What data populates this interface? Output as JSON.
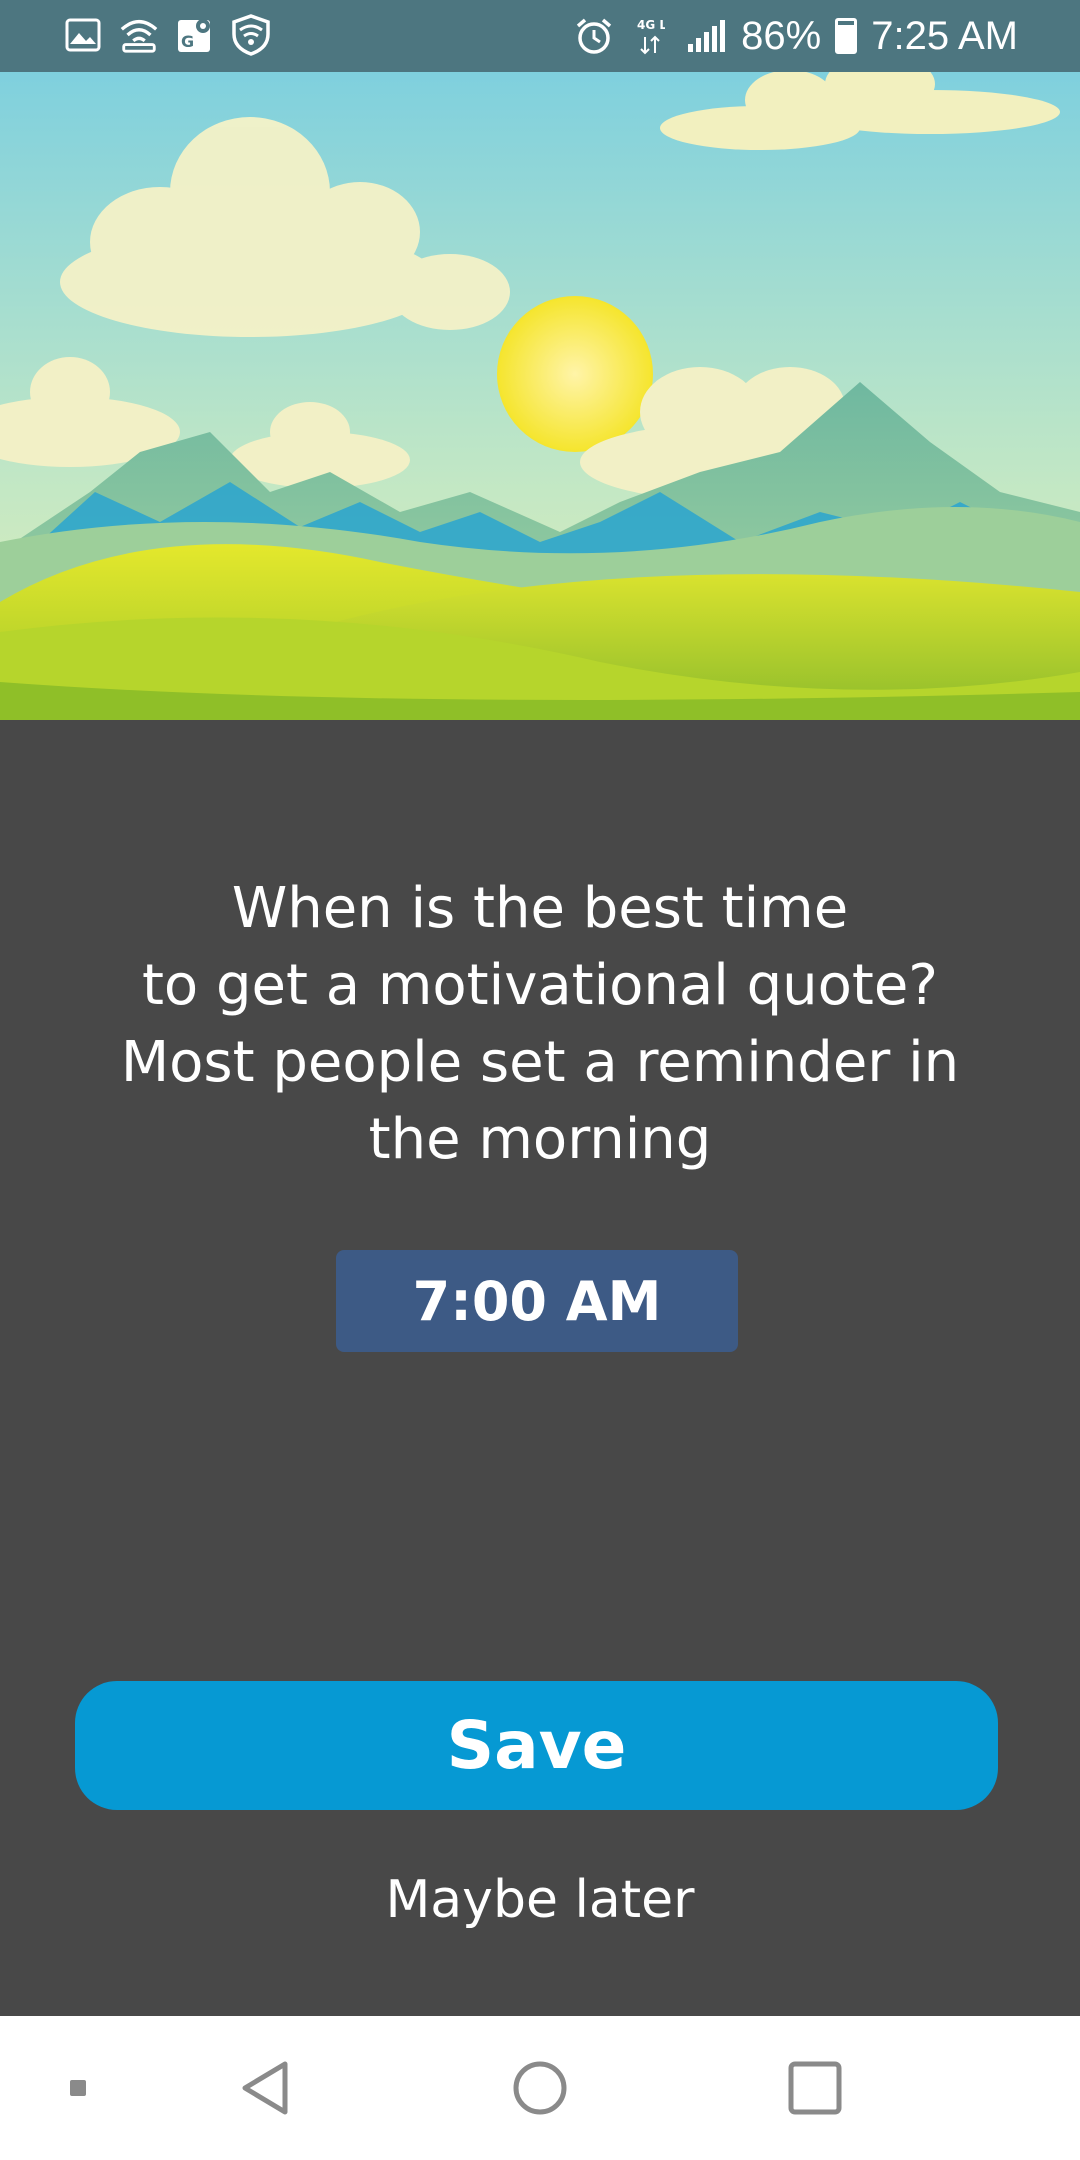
{
  "status_bar": {
    "left_icons": [
      "image-icon",
      "wifi-hotspot-icon",
      "maps-icon",
      "vpn-shield-icon"
    ],
    "right_icons": [
      "alarm-icon",
      "4g-lte-icon",
      "signal-icon",
      "battery-icon"
    ],
    "network_label": "4G LTE",
    "battery_text": "86%",
    "battery_level": 0.86,
    "time": "7:25 AM"
  },
  "hero": {
    "description_icon": "landscape-illustration"
  },
  "prompt": {
    "line1": "When is the best time",
    "line2": "to get a motivational quote?",
    "line3": "Most people set a reminder in",
    "line4": "the morning"
  },
  "time_picker": {
    "value": "7:00 AM"
  },
  "actions": {
    "save_label": "Save",
    "later_label": "Maybe later"
  },
  "nav_bar": {
    "items": [
      "dot-icon",
      "back-icon",
      "home-icon",
      "recents-icon"
    ]
  },
  "colors": {
    "background": "#484848",
    "status_bar": "#4d7680",
    "time_button": "#3d5a85",
    "save_button": "#0699d3"
  }
}
